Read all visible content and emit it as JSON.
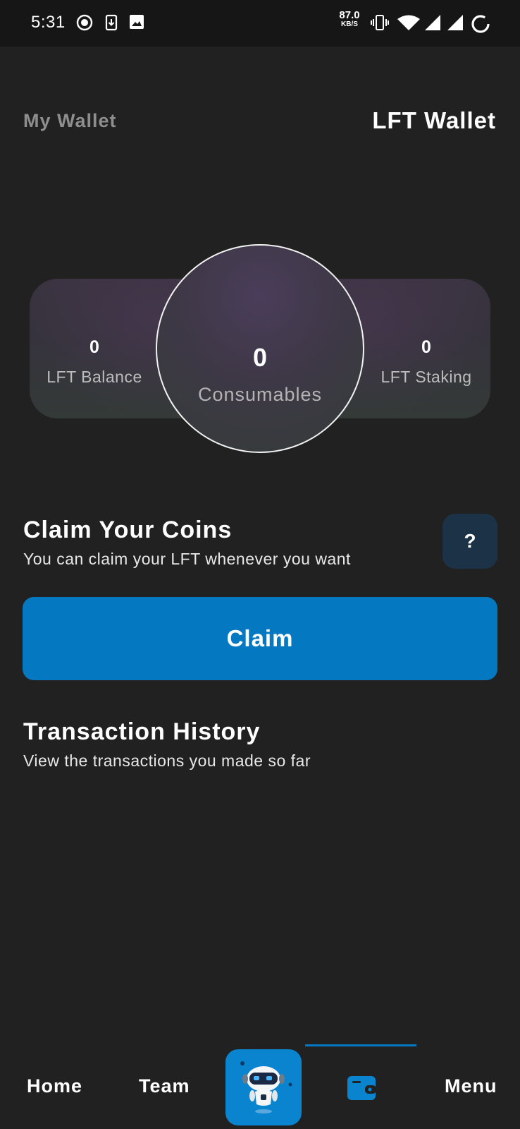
{
  "status_bar": {
    "time": "5:31",
    "net_speed": "87.0",
    "net_speed_unit": "KB/S",
    "icons": [
      "record-icon",
      "download-icon",
      "image-icon",
      "vibrate-icon",
      "wifi-icon",
      "signal-icon",
      "signal-icon",
      "battery-loading-icon"
    ]
  },
  "header": {
    "left_tab": "My Wallet",
    "title": "LFT Wallet"
  },
  "balances": {
    "lft_balance": {
      "value": "0",
      "label": "LFT Balance"
    },
    "consumables": {
      "value": "0",
      "label": "Consumables"
    },
    "lft_staking": {
      "value": "0",
      "label": "LFT Staking"
    }
  },
  "claim": {
    "title": "Claim Your Coins",
    "subtitle": "You can claim your LFT whenever you want",
    "help_label": "?",
    "button_label": "Claim"
  },
  "transactions": {
    "title": "Transaction History",
    "subtitle": "View the transactions you made so far"
  },
  "bottom_nav": {
    "items": [
      {
        "label": "Home"
      },
      {
        "label": "Team"
      },
      {
        "icon": "robot-icon"
      },
      {
        "icon": "wallet-icon",
        "active": true
      },
      {
        "label": "Menu"
      }
    ]
  },
  "colors": {
    "background": "#212121",
    "accent": "#0479c2",
    "help_button": "#1c3347",
    "muted_text": "#8e8e8e"
  }
}
